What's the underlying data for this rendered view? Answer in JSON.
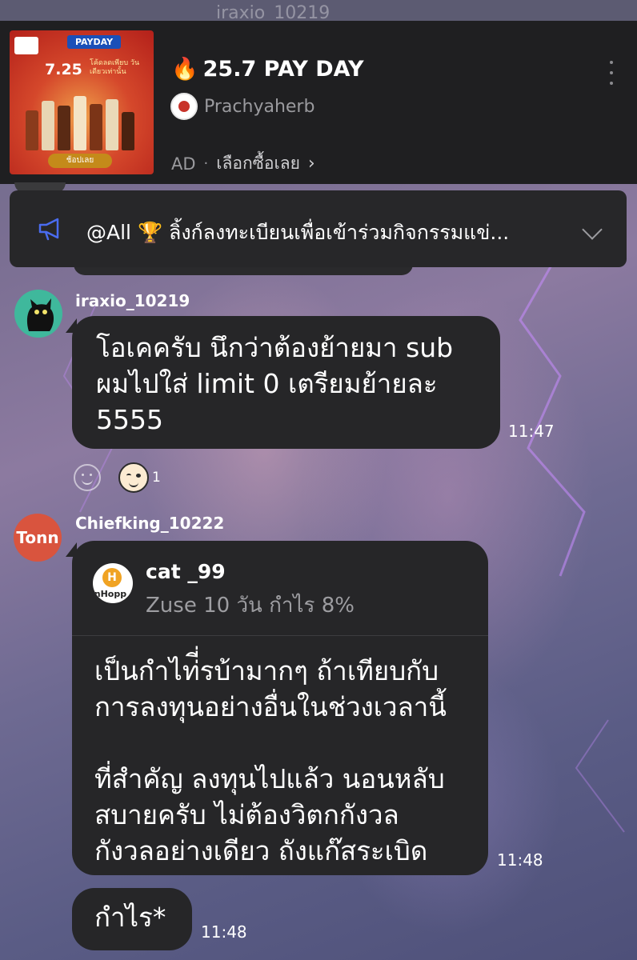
{
  "ghost_top": {
    "text": "iraxio_10219"
  },
  "ad": {
    "thumbnail": {
      "badge": "PAYDAY",
      "date": "7.25",
      "subtitle": "โค้ดลดเพียบ วันเดียวเท่านั้น",
      "button": "ช้อปเลย"
    },
    "fire_icon": "🔥",
    "title": "25.7 PAY DAY",
    "brand_name": "Prachyaherb",
    "ad_label": "AD",
    "cta_label": "เลือกซื้อเลย",
    "cta_chevron": "›"
  },
  "pinned": {
    "icon": "megaphone-icon",
    "text": "@All 🏆 ลิ้งก์ลงทะเบียนเพื่อเข้าร่วมกิจกรรมแข่..."
  },
  "messages": [
    {
      "username": "iraxio_10219",
      "avatar": "black-cat",
      "text": "โอเคครับ นึกว่าต้องย้ายมา sub\nผมไปใส่ limit 0 เตรียมย้ายละ\n5555",
      "time": "11:47",
      "reaction_count": "1"
    },
    {
      "username": "Chiefking_10222",
      "avatar_label": "Tonn",
      "quote": {
        "name": "cat _99",
        "avatar_letter": "H",
        "avatar_label": "inHopp",
        "text": "Zuse 10 วัน กำไร 8%"
      },
      "text": "เป็นกำไท่ี่รบ้ามากๆ ถ้าเทียบกับ\nการลงทุนอย่างอื่นในช่วงเวลานี้\n\nที่สำคัญ ลงทุนไปแล้ว นอนหลับ\nสบายครับ ไม่ต้องวิตกกังวล\nกังวลอย่างเดียว ถังแก๊สระเบิด",
      "time": "11:48"
    },
    {
      "text": "กำไร*",
      "time": "11:48"
    }
  ],
  "colors": {
    "bubble": "#262628",
    "banner": "#1f1f21",
    "accent_icon": "#4a6cf0",
    "tonn_avatar": "#d9543e",
    "cat_avatar": "#3fb89c"
  }
}
